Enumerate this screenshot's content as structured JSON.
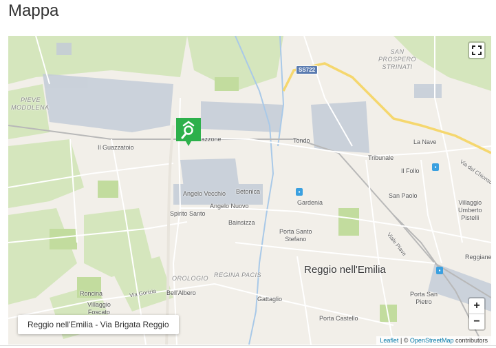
{
  "page": {
    "title": "Mappa"
  },
  "map": {
    "labels": {
      "san_prospero_l1": "SAN",
      "san_prospero_l2": "PROSPERO",
      "san_prospero_l3": "STRINATI",
      "pieve_l1": "PIEVE",
      "pieve_l2": "MODOLENA",
      "guazzatoio": "Il Guazzatoio",
      "mazzone": "Mazzone",
      "tondo": "Tondo",
      "la_nave": "La Nave",
      "tribunale": "Tribunale",
      "il_follo": "Il Follo",
      "via_del_chionso": "Via del Chionso",
      "angelo_vecchio": "Angelo Vecchio",
      "betonica": "Betonica",
      "angelo_nuovo": "Angelo Nuovo",
      "gardenia": "Gardenia",
      "san_paolo": "San Paolo",
      "villaggio_umberto_pistelli_l1": "Villaggio",
      "villaggio_umberto_pistelli_l2": "Umberto",
      "villaggio_umberto_pistelli_l3": "Pistelli",
      "spirito_santo": "Spirito Santo",
      "bainsizza": "Bainsizza",
      "porta_santo_stefano_l1": "Porta Santo",
      "porta_santo_stefano_l2": "Stefano",
      "viale_piave": "Viale Piave",
      "reggiane": "Reggiane",
      "city": "Reggio nell'Emilia",
      "orologio": "OROLOGIO",
      "regina_pacis": "REGINA PACIS",
      "roncina": "Roncina",
      "via_gorizia": "Via Gorizia",
      "bell_albero": "Bell'Albero",
      "villaggio_foscato_l1": "Villaggio",
      "villaggio_foscato_l2": "Foscato",
      "gattaglio": "Gattaglio",
      "porta_castello": "Porta Castello",
      "porta_san_pietro_l1": "Porta San",
      "porta_san_pietro_l2": "Pietro",
      "road_shield": "SS722"
    },
    "popup_text": "Reggio nell'Emilia - Via Brigata Reggio",
    "zoom_in": "+",
    "zoom_out": "−",
    "attribution": {
      "leaflet": "Leaflet",
      "separator": " | © ",
      "osm": "OpenStreetMap",
      "contributors": " contributors"
    },
    "colors": {
      "background": "#f2efe9",
      "park": "#c8e0a8",
      "water": "#a9c9e8",
      "industrial": "#c4ccd8",
      "major_road": "#f5d76e",
      "marker": "#2db04b"
    }
  }
}
